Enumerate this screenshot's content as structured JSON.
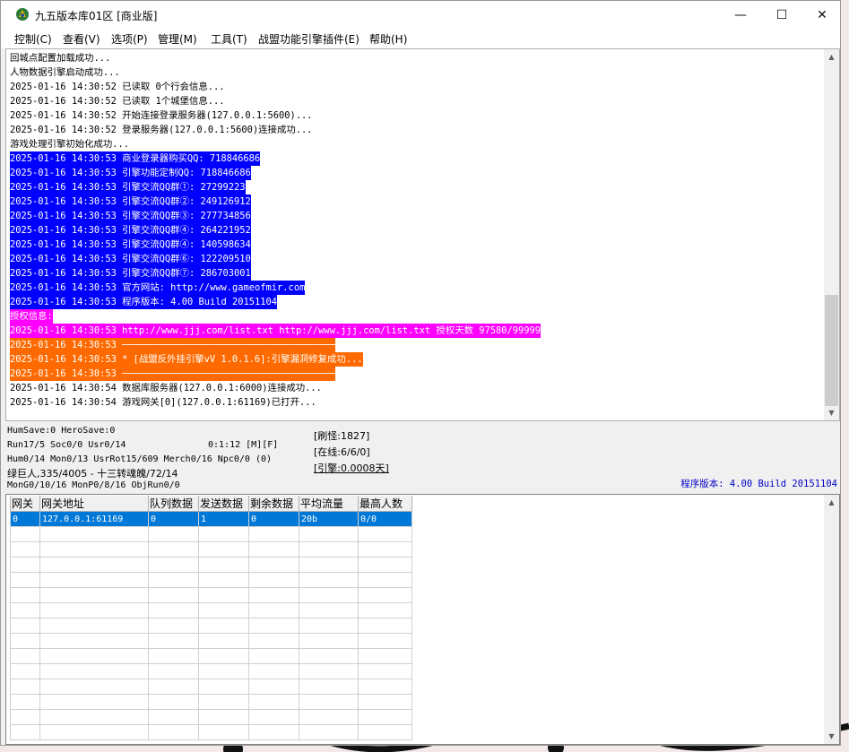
{
  "window": {
    "title": "九五版本库01区 [商业版]",
    "controls": {
      "minimize": "—",
      "maximize": "☐",
      "close": "✕"
    }
  },
  "menu": [
    {
      "label": "控制(C)"
    },
    {
      "label": "查看(V)"
    },
    {
      "label": "选项(P)"
    },
    {
      "label": "管理(M)"
    },
    {
      "label": "工具(T)"
    },
    {
      "label": "战盟功能引擎插件(E)"
    },
    {
      "label": "帮助(H)"
    }
  ],
  "log": [
    {
      "text": "回城点配置加载成功...",
      "style": "plain"
    },
    {
      "text": "人物数据引擎启动成功...",
      "style": "plain"
    },
    {
      "text": "2025-01-16 14:30:52 已读取 0个行会信息...",
      "style": "plain"
    },
    {
      "text": "2025-01-16 14:30:52 已读取 1个城堡信息...",
      "style": "plain"
    },
    {
      "text": "2025-01-16 14:30:52 开始连接登录服务器(127.0.0.1:5600)...",
      "style": "plain"
    },
    {
      "text": "2025-01-16 14:30:52 登录服务器(127.0.0.1:5600)连接成功...",
      "style": "plain"
    },
    {
      "text": "游戏处理引擎初始化成功...",
      "style": "plain"
    },
    {
      "text": "2025-01-16 14:30:53 商业登录器购买QQ: 718846686",
      "style": "blue"
    },
    {
      "text": "2025-01-16 14:30:53 引擎功能定制QQ: 718846686",
      "style": "blue"
    },
    {
      "text": "2025-01-16 14:30:53 引擎交流QQ群①: 27299223",
      "style": "blue"
    },
    {
      "text": "2025-01-16 14:30:53 引擎交流QQ群②: 249126912",
      "style": "blue"
    },
    {
      "text": "2025-01-16 14:30:53 引擎交流QQ群③: 277734856",
      "style": "blue"
    },
    {
      "text": "2025-01-16 14:30:53 引擎交流QQ群④: 264221952",
      "style": "blue"
    },
    {
      "text": "2025-01-16 14:30:53 引擎交流QQ群④: 140598634",
      "style": "blue"
    },
    {
      "text": "2025-01-16 14:30:53 引擎交流QQ群⑥: 122209510",
      "style": "blue"
    },
    {
      "text": "2025-01-16 14:30:53 引擎交流QQ群⑦: 286703001",
      "style": "blue"
    },
    {
      "text": "2025-01-16 14:30:53 官方网站: http://www.gameofmir.com",
      "style": "blue"
    },
    {
      "text": "2025-01-16 14:30:53 程序版本: 4.00 Build 20151104",
      "style": "blue"
    },
    {
      "text": "授权信息:",
      "style": "magenta"
    },
    {
      "text": "2025-01-16 14:30:53 http://www.jjj.com/list.txt http://www.jjj.com/list.txt 授权天数 97580/99999",
      "style": "magenta"
    },
    {
      "text": "2025-01-16 14:30:53 ──────────────────────────────────────",
      "style": "orange"
    },
    {
      "text": "2025-01-16 14:30:53 * [战盟反外挂引擎vV 1.0.1.6]:引擎漏洞修复成功...",
      "style": "orange"
    },
    {
      "text": "2025-01-16 14:30:53 ──────────────────────────────────────",
      "style": "orange"
    },
    {
      "text": "2025-01-16 14:30:54 数据库服务器(127.0.0.1:6000)连接成功...",
      "style": "plain"
    },
    {
      "text": "2025-01-16 14:30:54 游戏网关[0](127.0.0.1:61169)已打开...",
      "style": "plain"
    }
  ],
  "status": {
    "line1": "HumSave:0 HeroSave:0",
    "line2": "Run17/5 Soc0/0 Usr0/14",
    "time": "0:1:12 [M][F]",
    "line3": "Hum0/14 Mon0/13 UsrRot15/609 Merch0/16 Npc0/0 (0)",
    "line4": "绿巨人,335/4005 - 十三转魂魄/72/14",
    "line5": "MonG0/10/16 MonP0/8/16 ObjRun0/0",
    "refresh": "[刷怪:1827]",
    "online": "[在线:6/6/0]",
    "engine": "[引擎:0.0008天]",
    "version": "程序版本: 4.00 Build 20151104"
  },
  "table": {
    "columns": [
      "网关",
      "网关地址",
      "队列数据",
      "发送数据",
      "剩余数据",
      "平均流量",
      "最高人数"
    ],
    "rows": [
      [
        "0",
        "127.0.0.1:61169",
        "0",
        "1",
        "0",
        "20b",
        "0/0"
      ]
    ],
    "empty_rows": 14
  },
  "colors": {
    "log_blue": "#0000ff",
    "log_magenta": "#ff00ff",
    "log_orange": "#ff6a00",
    "selection": "#0078d7",
    "version_text": "#0000c8"
  }
}
